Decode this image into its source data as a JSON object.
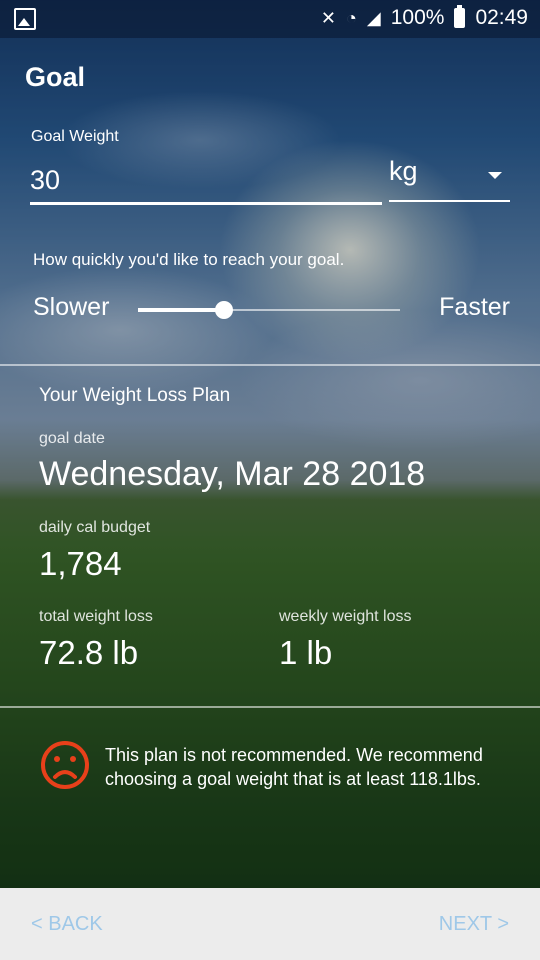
{
  "statusbar": {
    "battery_percent": "100%",
    "time": "02:49",
    "icons": [
      "gallery-icon",
      "mute-icon",
      "wifi-icon",
      "signal-icon",
      "battery-icon"
    ]
  },
  "header": {
    "title": "Goal"
  },
  "goal": {
    "label": "Goal Weight",
    "value": "30",
    "unit": "kg"
  },
  "speed": {
    "label": "How quickly you'd like to reach your goal.",
    "slower": "Slower",
    "faster": "Faster",
    "level": 0.33
  },
  "plan": {
    "title": "Your Weight Loss Plan",
    "goal_date_label": "goal date",
    "goal_date": "Wednesday, Mar 28 2018",
    "budget_label": "daily cal budget",
    "budget": "1,784",
    "total_loss_label": "total weight loss",
    "total_loss": "72.8 lb",
    "weekly_loss_label": "weekly weight loss",
    "weekly_loss": "1 lb"
  },
  "warning": {
    "icon": "sad-face-icon",
    "color": "#e8401a",
    "text": "This plan is not recommended. We recommend choosing a goal weight that is at least 118.1lbs."
  },
  "footer": {
    "back": "< BACK",
    "next": "NEXT >",
    "accent": "#9fc8e8"
  }
}
